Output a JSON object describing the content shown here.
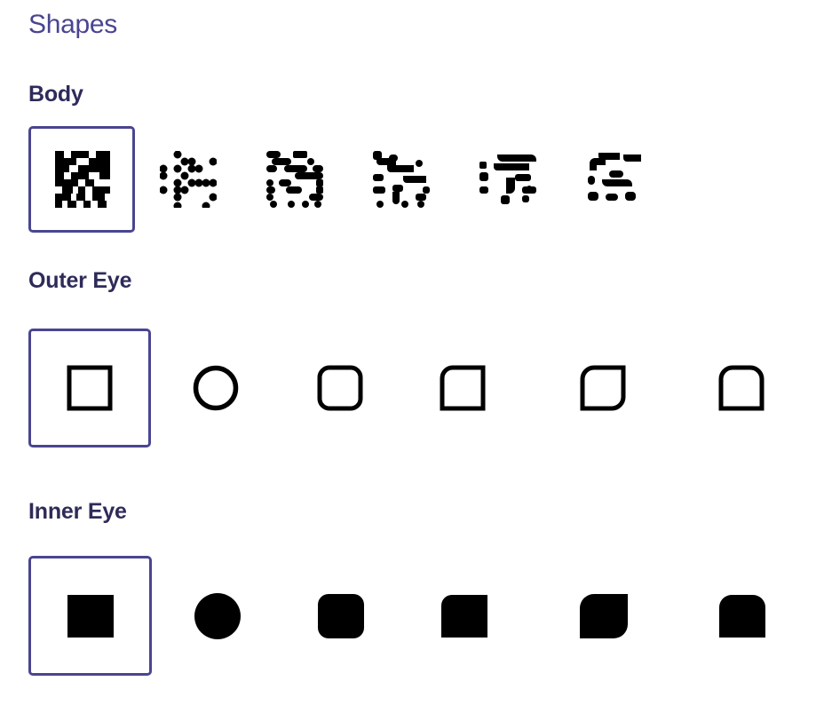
{
  "title": "Shapes",
  "accent_color": "#4a4590",
  "sections": {
    "body": {
      "label": "Body",
      "options": [
        {
          "icon": "square-modules-pattern-icon",
          "selected": true
        },
        {
          "icon": "dots-pattern-icon",
          "selected": false
        },
        {
          "icon": "rounded-modules-pattern-icon",
          "selected": false
        },
        {
          "icon": "classy-pattern-icon",
          "selected": false
        },
        {
          "icon": "classy-rounded-pattern-icon",
          "selected": false
        },
        {
          "icon": "extra-rounded-pattern-icon",
          "selected": false
        }
      ]
    },
    "outer_eye": {
      "label": "Outer Eye",
      "options": [
        {
          "icon": "square-frame-icon",
          "selected": true
        },
        {
          "icon": "circle-frame-icon",
          "selected": false
        },
        {
          "icon": "rounded-square-frame-icon",
          "selected": false
        },
        {
          "icon": "top-left-rounded-frame-icon",
          "selected": false
        },
        {
          "icon": "leaf-frame-icon",
          "selected": false
        },
        {
          "icon": "top-rounded-frame-icon",
          "selected": false
        }
      ]
    },
    "inner_eye": {
      "label": "Inner Eye",
      "options": [
        {
          "icon": "filled-square-icon",
          "selected": true
        },
        {
          "icon": "filled-circle-icon",
          "selected": false
        },
        {
          "icon": "filled-rounded-square-icon",
          "selected": false
        },
        {
          "icon": "filled-top-left-rounded-icon",
          "selected": false
        },
        {
          "icon": "filled-leaf-icon",
          "selected": false
        },
        {
          "icon": "filled-top-rounded-icon",
          "selected": false
        }
      ]
    }
  }
}
